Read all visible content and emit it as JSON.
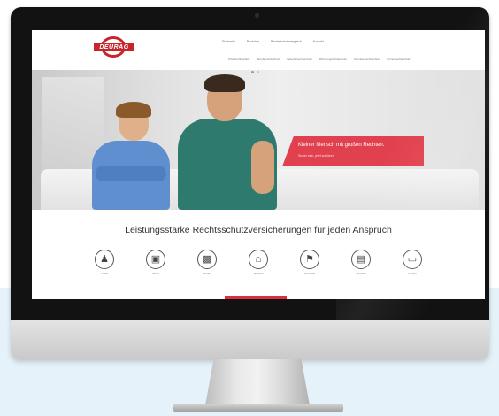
{
  "site": {
    "logo_text": "DEURAG",
    "nav": {
      "primary": [
        "Startseite",
        "Produkte",
        "Rechtsschutzvergleich",
        "Kontakt"
      ],
      "secondary": [
        "Privatrechtsschutz",
        "Berufsrechtsschutz",
        "Verkehrsrechtsschutz",
        "Wohnungsrechtsschutz",
        "Vermieterrechtsschutz",
        "Firmenrechtsschutz"
      ]
    },
    "hero": {
      "promo_title": "Kleiner Mensch mit großen Rechten.",
      "promo_subtitle": "Sicher sein, jetzt schützen"
    },
    "section_title": "Leistungsstarke Rechtsschutzversicherungen für jeden Anspruch",
    "products": [
      {
        "label": "Privat",
        "icon": "person-icon"
      },
      {
        "label": "Beruf",
        "icon": "monitor-icon"
      },
      {
        "label": "Verkehr",
        "icon": "car-icon"
      },
      {
        "label": "Wohnen",
        "icon": "house-icon"
      },
      {
        "label": "Vermieter",
        "icon": "key-icon"
      },
      {
        "label": "Senioren",
        "icon": "document-icon"
      },
      {
        "label": "Firmen",
        "icon": "vehicle-icon"
      }
    ]
  },
  "colors": {
    "accent": "#e1414e",
    "brand": "#c8242b",
    "background_panel": "#e6f2fa"
  }
}
